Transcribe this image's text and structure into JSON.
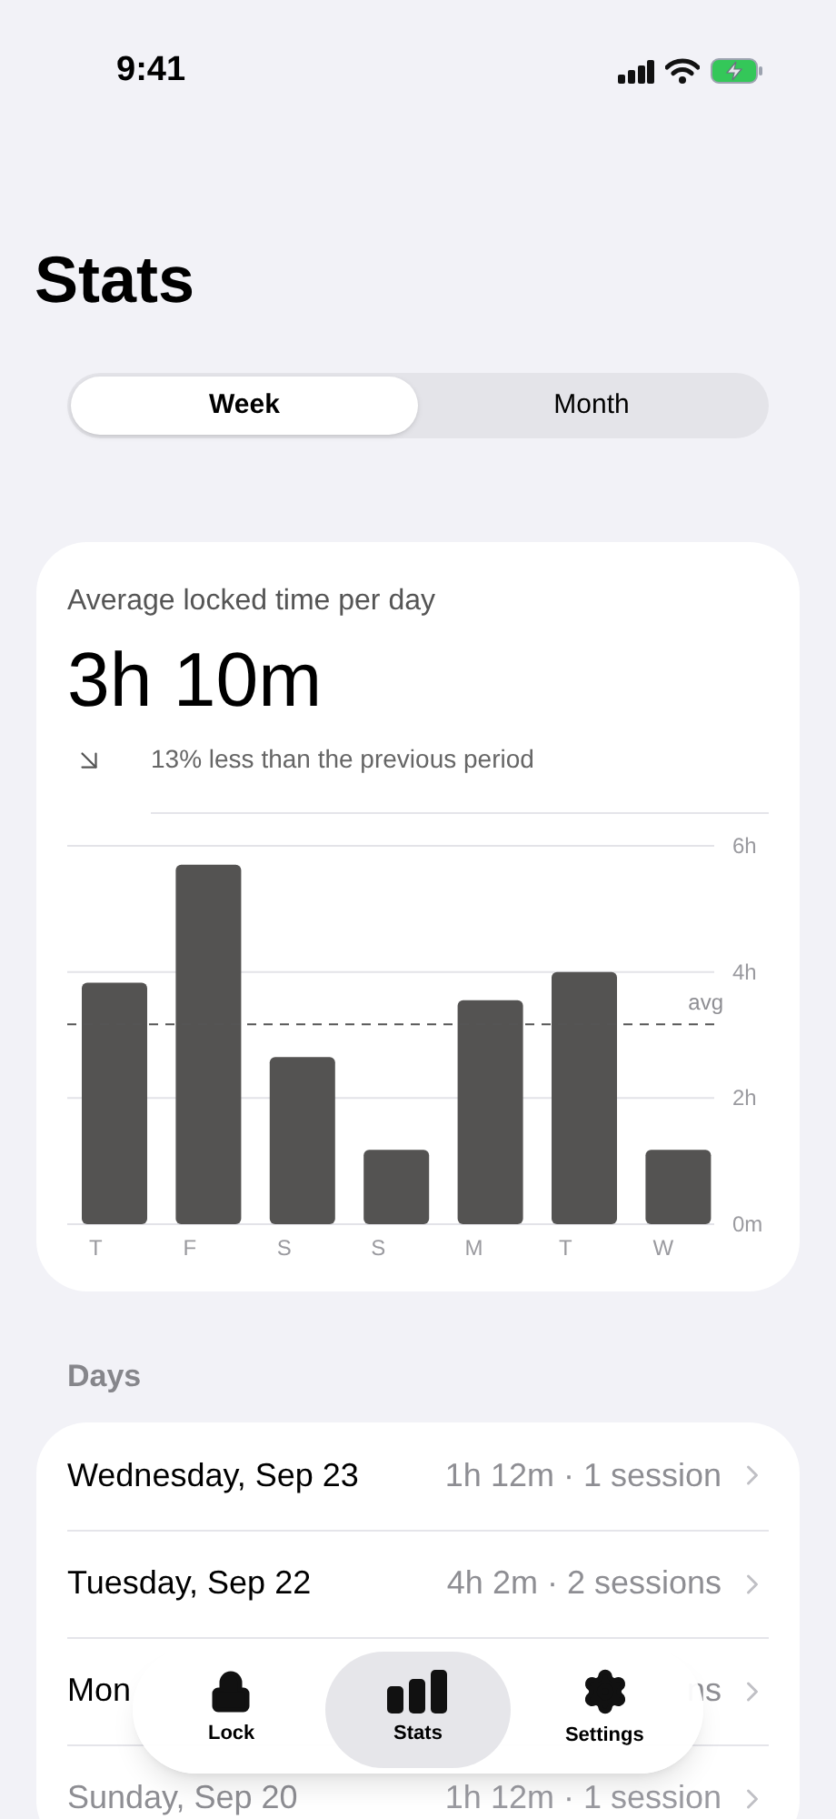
{
  "status_bar": {
    "time": "9:41"
  },
  "title": "Stats",
  "segments": [
    {
      "label": "Week",
      "selected": true
    },
    {
      "label": "Month",
      "selected": false
    }
  ],
  "summary": {
    "caption": "Average locked time per day",
    "value": "3h 10m",
    "trend": "13% less than the previous period"
  },
  "chart_data": {
    "type": "bar",
    "categories": [
      "T",
      "F",
      "S",
      "S",
      "M",
      "T",
      "W"
    ],
    "values": [
      3.83,
      5.7,
      2.65,
      1.18,
      3.55,
      4.0,
      1.18
    ],
    "ylim": [
      0,
      6
    ],
    "yticks": [
      {
        "value": 0,
        "label": "0m"
      },
      {
        "value": 2,
        "label": "2h"
      },
      {
        "value": 4,
        "label": "4h"
      },
      {
        "value": 6,
        "label": "6h"
      }
    ],
    "ref_lines": [
      {
        "axis": "y",
        "value": 3.17,
        "label": "avg"
      }
    ]
  },
  "days_heading": "Days",
  "days": [
    {
      "name": "Wednesday, Sep 23",
      "detail": "1h 12m · 1 session",
      "faded": false
    },
    {
      "name": "Tuesday, Sep 22",
      "detail": "4h 2m · 2 sessions",
      "faded": false
    },
    {
      "name": "Mon",
      "detail": "ns",
      "faded": false
    },
    {
      "name": "Sunday, Sep 20",
      "detail": "1h 12m · 1 session",
      "faded": true
    }
  ],
  "tab_bar": [
    {
      "kind": "lock",
      "label": "Lock",
      "selected": false
    },
    {
      "kind": "stats",
      "label": "Stats",
      "selected": true
    },
    {
      "kind": "settings",
      "label": "Settings",
      "selected": false
    }
  ]
}
